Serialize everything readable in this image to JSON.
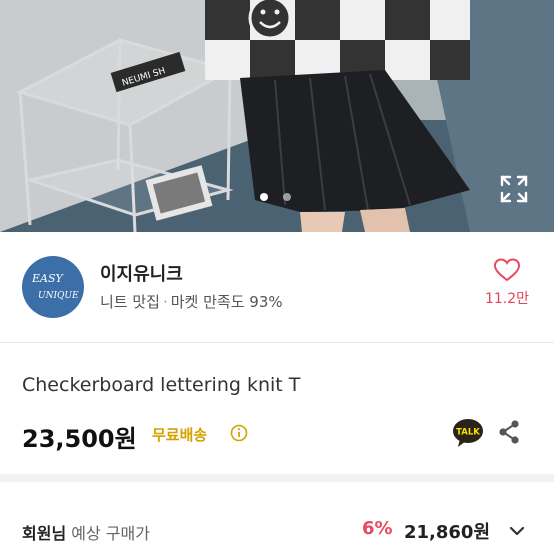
{
  "gallery": {
    "page_count": 2,
    "active_index": 0,
    "sign_text": "NEUMI SH",
    "expand_icon": "expand-icon"
  },
  "shop": {
    "logo_text_1": "EASY",
    "logo_text_2": "UNIQUE",
    "name": "이지유니크",
    "category": "니트 맛집",
    "separator": "·",
    "satisfaction": "마켓 만족도 93%",
    "like_count": "11.2만",
    "like_icon": "heart-icon"
  },
  "product": {
    "title": "Checkerboard lettering knit T",
    "price": "23,500원",
    "shipping": "무료배송",
    "talk_label": "TALK",
    "info_icon": "info-icon",
    "share_icon": "share-icon"
  },
  "member_price": {
    "label_bold": "회원님",
    "label_rest": " 예상 구매가",
    "discount": "6%",
    "price": "21,860원",
    "chevron_icon": "chevron-down-icon"
  },
  "colors": {
    "accent_red": "#e84a5f",
    "shipping_yellow": "#d4a200",
    "logo_blue": "#3c6ea8",
    "kakao_yellow": "#f9e000"
  }
}
